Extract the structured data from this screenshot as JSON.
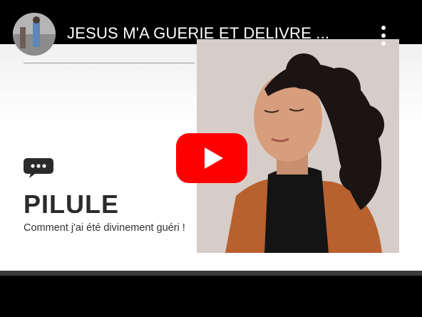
{
  "header": {
    "title": "JESUS M'A GUERIE ET DELIVRE ...",
    "avatar_icon": "channel-avatar-icon",
    "menu_icon": "more-vertical-icon"
  },
  "thumbnail": {
    "heading": "PILULE",
    "subtitle": "Comment j'ai été divinement guéri !",
    "chat_icon": "chat-bubble-icon"
  },
  "player": {
    "play_icon": "youtube-play-icon"
  },
  "colors": {
    "youtube_red": "#ff0000",
    "heading_text": "#2b2b2b",
    "background": "#000000"
  }
}
